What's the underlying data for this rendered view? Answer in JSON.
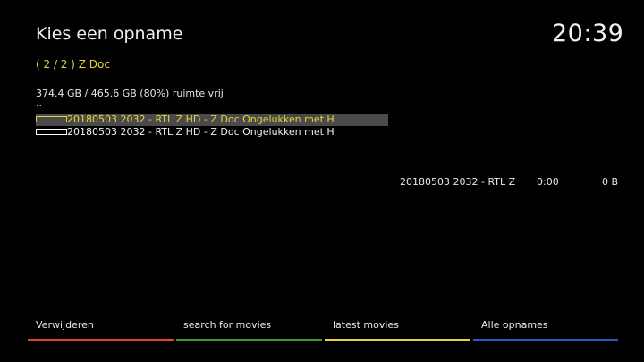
{
  "header": {
    "title": "Kies een opname",
    "clock": "20:39"
  },
  "breadcrumb": "( 2 / 2 )  Z Doc",
  "disk_space": "374.4 GB / 465.6 GB (80%) ruimte vrij",
  "parent_dir": "..",
  "recordings": [
    {
      "label": "20180503 2032 - RTL Z HD - Z Doc  Ongelukken met H",
      "selected": true
    },
    {
      "label": "20180503 2032 - RTL Z HD - Z Doc  Ongelukken met H",
      "selected": false
    }
  ],
  "info": {
    "name": "20180503 2032 - RTL Z",
    "duration": "0:00",
    "size": "0 B"
  },
  "function_keys": [
    {
      "label": "Verwijderen",
      "color": "#e2412c"
    },
    {
      "label": "search for movies",
      "color": "#3a9a2e"
    },
    {
      "label": "latest movies",
      "color": "#e8d23c"
    },
    {
      "label": "Alle opnames",
      "color": "#1f5fb8"
    }
  ],
  "colors": {
    "highlight_text": "#e8d23c",
    "selection_bg": "#4a4a4a"
  }
}
